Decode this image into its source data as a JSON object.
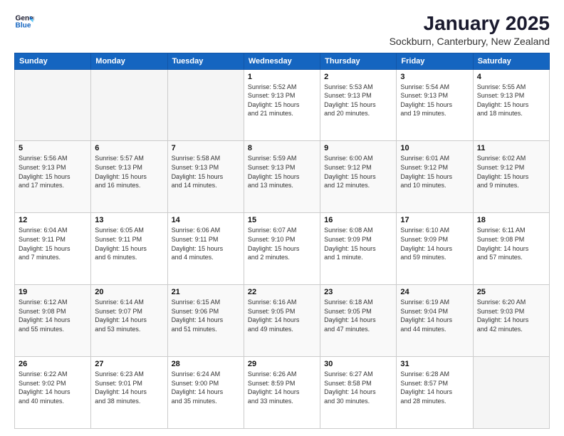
{
  "header": {
    "logo_line1": "General",
    "logo_line2": "Blue",
    "title": "January 2025",
    "subtitle": "Sockburn, Canterbury, New Zealand"
  },
  "days_of_week": [
    "Sunday",
    "Monday",
    "Tuesday",
    "Wednesday",
    "Thursday",
    "Friday",
    "Saturday"
  ],
  "weeks": [
    [
      {
        "day": "",
        "detail": ""
      },
      {
        "day": "",
        "detail": ""
      },
      {
        "day": "",
        "detail": ""
      },
      {
        "day": "1",
        "detail": "Sunrise: 5:52 AM\nSunset: 9:13 PM\nDaylight: 15 hours\nand 21 minutes."
      },
      {
        "day": "2",
        "detail": "Sunrise: 5:53 AM\nSunset: 9:13 PM\nDaylight: 15 hours\nand 20 minutes."
      },
      {
        "day": "3",
        "detail": "Sunrise: 5:54 AM\nSunset: 9:13 PM\nDaylight: 15 hours\nand 19 minutes."
      },
      {
        "day": "4",
        "detail": "Sunrise: 5:55 AM\nSunset: 9:13 PM\nDaylight: 15 hours\nand 18 minutes."
      }
    ],
    [
      {
        "day": "5",
        "detail": "Sunrise: 5:56 AM\nSunset: 9:13 PM\nDaylight: 15 hours\nand 17 minutes."
      },
      {
        "day": "6",
        "detail": "Sunrise: 5:57 AM\nSunset: 9:13 PM\nDaylight: 15 hours\nand 16 minutes."
      },
      {
        "day": "7",
        "detail": "Sunrise: 5:58 AM\nSunset: 9:13 PM\nDaylight: 15 hours\nand 14 minutes."
      },
      {
        "day": "8",
        "detail": "Sunrise: 5:59 AM\nSunset: 9:13 PM\nDaylight: 15 hours\nand 13 minutes."
      },
      {
        "day": "9",
        "detail": "Sunrise: 6:00 AM\nSunset: 9:12 PM\nDaylight: 15 hours\nand 12 minutes."
      },
      {
        "day": "10",
        "detail": "Sunrise: 6:01 AM\nSunset: 9:12 PM\nDaylight: 15 hours\nand 10 minutes."
      },
      {
        "day": "11",
        "detail": "Sunrise: 6:02 AM\nSunset: 9:12 PM\nDaylight: 15 hours\nand 9 minutes."
      }
    ],
    [
      {
        "day": "12",
        "detail": "Sunrise: 6:04 AM\nSunset: 9:11 PM\nDaylight: 15 hours\nand 7 minutes."
      },
      {
        "day": "13",
        "detail": "Sunrise: 6:05 AM\nSunset: 9:11 PM\nDaylight: 15 hours\nand 6 minutes."
      },
      {
        "day": "14",
        "detail": "Sunrise: 6:06 AM\nSunset: 9:11 PM\nDaylight: 15 hours\nand 4 minutes."
      },
      {
        "day": "15",
        "detail": "Sunrise: 6:07 AM\nSunset: 9:10 PM\nDaylight: 15 hours\nand 2 minutes."
      },
      {
        "day": "16",
        "detail": "Sunrise: 6:08 AM\nSunset: 9:09 PM\nDaylight: 15 hours\nand 1 minute."
      },
      {
        "day": "17",
        "detail": "Sunrise: 6:10 AM\nSunset: 9:09 PM\nDaylight: 14 hours\nand 59 minutes."
      },
      {
        "day": "18",
        "detail": "Sunrise: 6:11 AM\nSunset: 9:08 PM\nDaylight: 14 hours\nand 57 minutes."
      }
    ],
    [
      {
        "day": "19",
        "detail": "Sunrise: 6:12 AM\nSunset: 9:08 PM\nDaylight: 14 hours\nand 55 minutes."
      },
      {
        "day": "20",
        "detail": "Sunrise: 6:14 AM\nSunset: 9:07 PM\nDaylight: 14 hours\nand 53 minutes."
      },
      {
        "day": "21",
        "detail": "Sunrise: 6:15 AM\nSunset: 9:06 PM\nDaylight: 14 hours\nand 51 minutes."
      },
      {
        "day": "22",
        "detail": "Sunrise: 6:16 AM\nSunset: 9:05 PM\nDaylight: 14 hours\nand 49 minutes."
      },
      {
        "day": "23",
        "detail": "Sunrise: 6:18 AM\nSunset: 9:05 PM\nDaylight: 14 hours\nand 47 minutes."
      },
      {
        "day": "24",
        "detail": "Sunrise: 6:19 AM\nSunset: 9:04 PM\nDaylight: 14 hours\nand 44 minutes."
      },
      {
        "day": "25",
        "detail": "Sunrise: 6:20 AM\nSunset: 9:03 PM\nDaylight: 14 hours\nand 42 minutes."
      }
    ],
    [
      {
        "day": "26",
        "detail": "Sunrise: 6:22 AM\nSunset: 9:02 PM\nDaylight: 14 hours\nand 40 minutes."
      },
      {
        "day": "27",
        "detail": "Sunrise: 6:23 AM\nSunset: 9:01 PM\nDaylight: 14 hours\nand 38 minutes."
      },
      {
        "day": "28",
        "detail": "Sunrise: 6:24 AM\nSunset: 9:00 PM\nDaylight: 14 hours\nand 35 minutes."
      },
      {
        "day": "29",
        "detail": "Sunrise: 6:26 AM\nSunset: 8:59 PM\nDaylight: 14 hours\nand 33 minutes."
      },
      {
        "day": "30",
        "detail": "Sunrise: 6:27 AM\nSunset: 8:58 PM\nDaylight: 14 hours\nand 30 minutes."
      },
      {
        "day": "31",
        "detail": "Sunrise: 6:28 AM\nSunset: 8:57 PM\nDaylight: 14 hours\nand 28 minutes."
      },
      {
        "day": "",
        "detail": ""
      }
    ]
  ]
}
